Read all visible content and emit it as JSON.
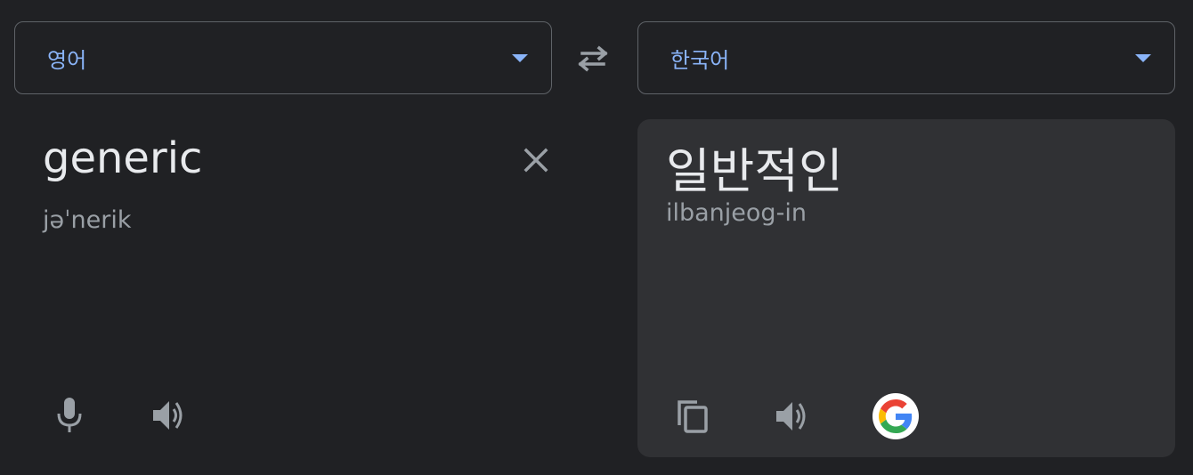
{
  "source": {
    "language": "영어",
    "text": "generic",
    "phonetic": "jəˈnerik"
  },
  "target": {
    "language": "한국어",
    "text": "일반적인",
    "romanization": "ilbanjeog-in"
  },
  "icons": {
    "swap": "swap-icon",
    "clear": "close-icon",
    "mic": "microphone-icon",
    "listen": "speaker-icon",
    "copy": "copy-icon",
    "google": "google-logo-icon"
  },
  "colors": {
    "background": "#202124",
    "panel": "#303134",
    "accent": "#8ab4f8",
    "border": "#5f6368",
    "icon": "#9aa0a6"
  }
}
